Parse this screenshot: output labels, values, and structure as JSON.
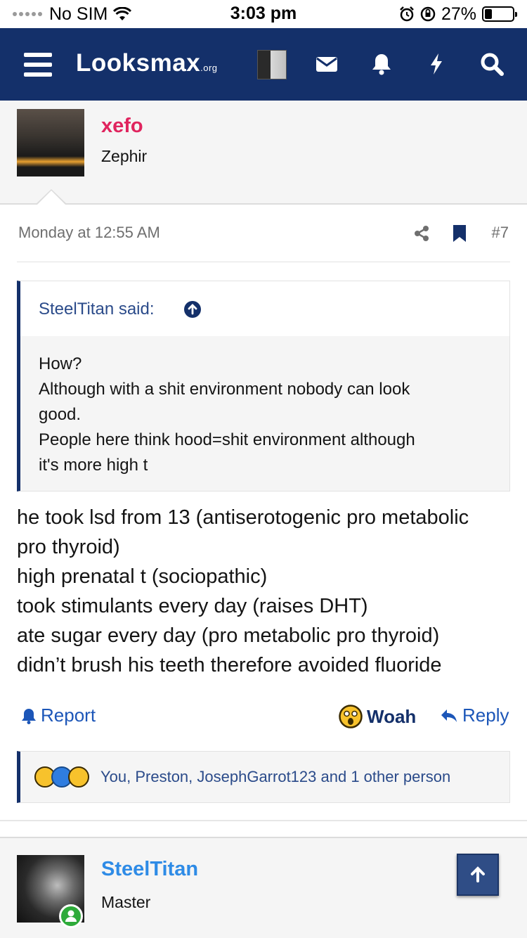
{
  "status_bar": {
    "carrier": "No SIM",
    "time": "3:03 pm",
    "battery_percent": "27%",
    "battery_level": 0.27
  },
  "nav": {
    "logo_main": "Looksmax",
    "logo_suffix": ".org",
    "icons": [
      "menu-icon",
      "user-avatar",
      "mail-icon",
      "bell-icon",
      "bolt-icon",
      "search-icon"
    ]
  },
  "post": {
    "author": {
      "name": "xefo",
      "title": "Zephir",
      "name_color": "#e0245e"
    },
    "date": "Monday at 12:55 AM",
    "number": "#7",
    "quote": {
      "author_line": "SteelTitan said:",
      "lines": [
        "How?",
        "Although with a shit environment nobody can look",
        "good.",
        "People here think hood=shit environment although",
        "it's more high t"
      ]
    },
    "message_lines": [
      "he took lsd from 13 (antiserotogenic pro metabolic",
      "pro thyroid)",
      "high prenatal t (sociopathic)",
      "took stimulants every day (raises DHT)",
      "ate sugar every day (pro metabolic pro thyroid)",
      "didn’t brush his teeth therefore avoided fluoride"
    ],
    "actions": {
      "report": "Report",
      "reaction": "Woah",
      "reply": "Reply"
    },
    "reactions": {
      "emojis": [
        "thinking-emoji",
        "like-emoji",
        "woah-emoji"
      ],
      "users": "You, Preston, JosephGarrot123 and 1 other person"
    }
  },
  "next_post": {
    "author": {
      "name": "SteelTitan",
      "title": "Master",
      "name_color": "#2e8be6"
    }
  },
  "colors": {
    "nav_bg": "#14306a",
    "link": "#1c56b8",
    "quote_bar": "#14306a"
  }
}
